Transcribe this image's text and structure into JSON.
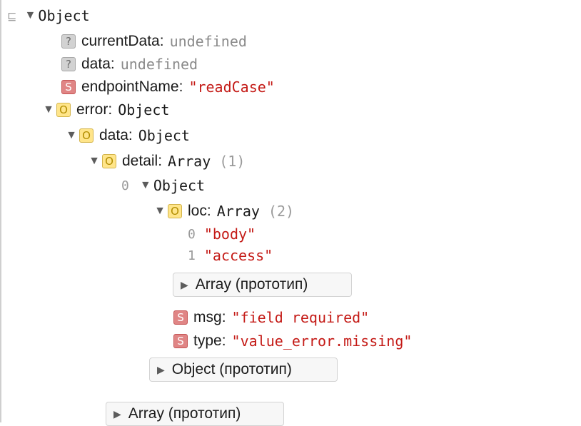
{
  "root": {
    "label": "Object"
  },
  "fields": {
    "currentData": {
      "key": "currentData",
      "value": "undefined"
    },
    "data": {
      "key": "data",
      "value": "undefined"
    },
    "endpointName": {
      "key": "endpointName",
      "value": "\"readCase\""
    },
    "error": {
      "key": "error",
      "value": "Object"
    }
  },
  "error": {
    "data": {
      "key": "data",
      "value": "Object"
    },
    "detail": {
      "key": "detail",
      "value": "Array",
      "count": "(1)"
    },
    "item0": {
      "index": "0",
      "value": "Object"
    },
    "loc": {
      "key": "loc",
      "value": "Array",
      "count": "(2)"
    },
    "loc_items": [
      {
        "index": "0",
        "value": "\"body\""
      },
      {
        "index": "1",
        "value": "\"access\""
      }
    ],
    "msg": {
      "key": "msg",
      "value": "\"field required\""
    },
    "type": {
      "key": "type",
      "value": "\"value_error.missing\""
    }
  },
  "prototypes": {
    "array_loc": "Array (прототип)",
    "object_item": "Object (прототип)",
    "array_detail": "Array (прототип)"
  },
  "badges": {
    "undefined": "?",
    "string": "S",
    "object": "O"
  },
  "colors": {
    "string": "#c41a16",
    "undefined": "#8a8a8a",
    "string_badge": "#e08585",
    "object_badge": "#ffe58a"
  }
}
